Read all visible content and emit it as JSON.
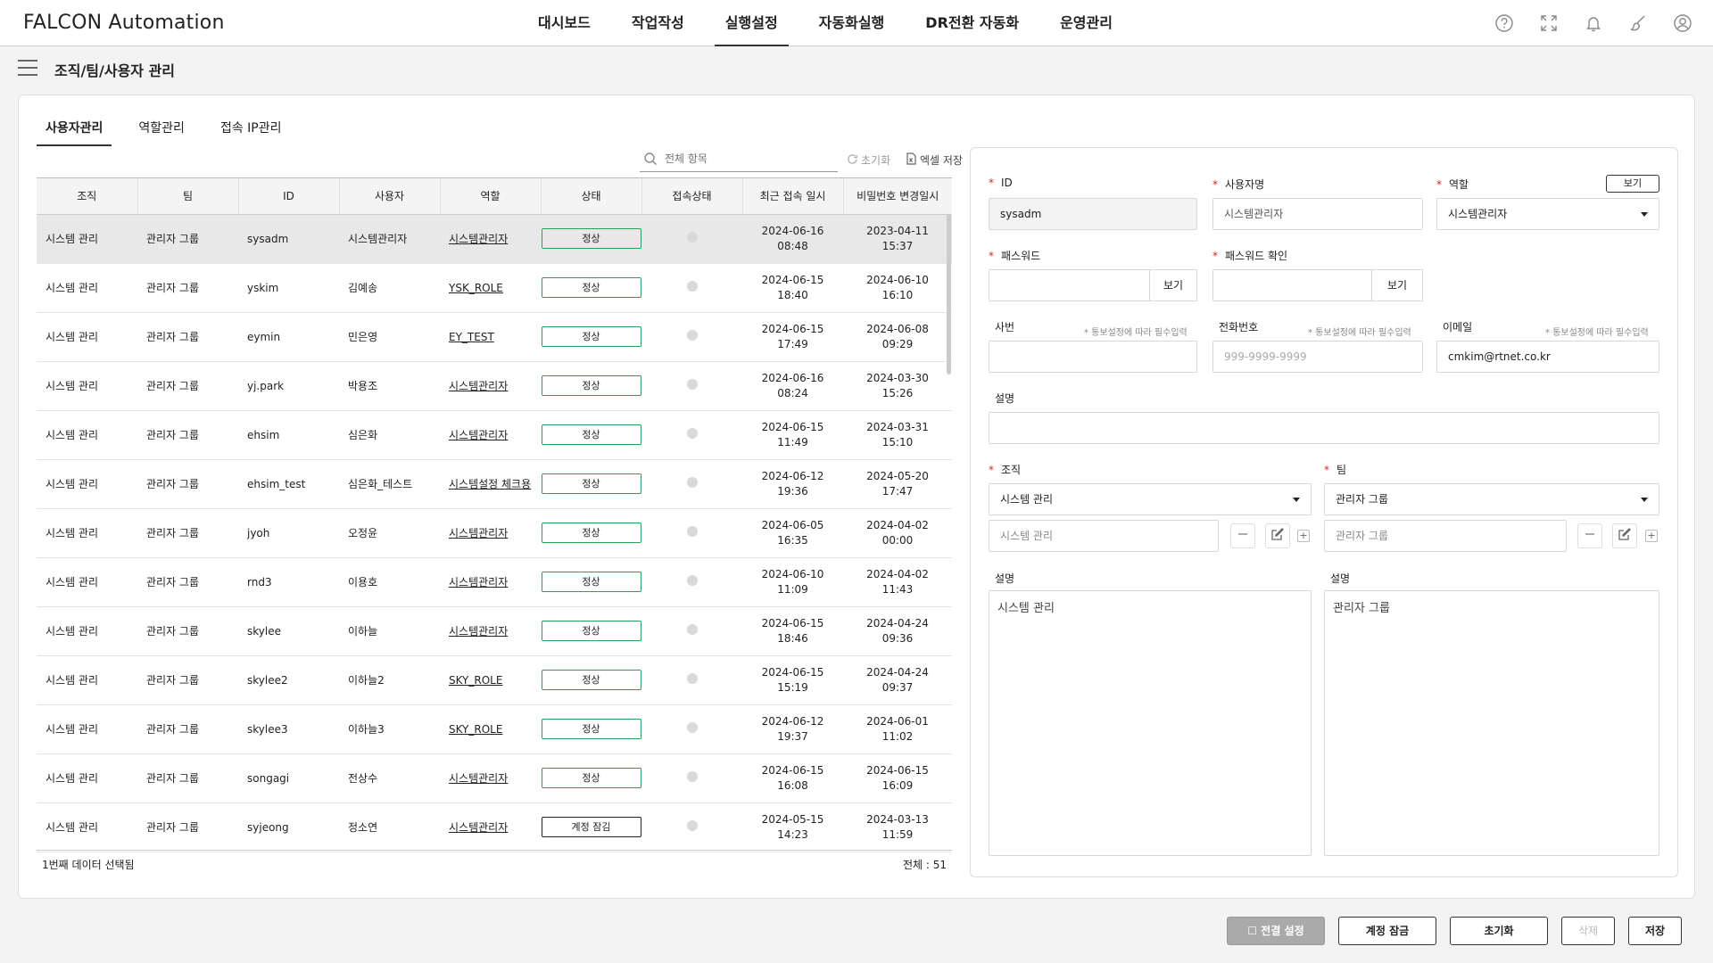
{
  "app": {
    "brand": "FALCON Automation"
  },
  "nav": {
    "menus": [
      {
        "label": "대시보드",
        "active": false
      },
      {
        "label": "작업작성",
        "active": false
      },
      {
        "label": "실행설정",
        "active": true
      },
      {
        "label": "자동화실행",
        "active": false
      },
      {
        "label": "DR전환 자동화",
        "active": false
      },
      {
        "label": "운영관리",
        "active": false
      }
    ],
    "icons": [
      "help-icon",
      "fullscreen-icon",
      "bell-icon",
      "brush-icon",
      "user-icon"
    ]
  },
  "page": {
    "title": "조직/팀/사용자 관리"
  },
  "tabs": [
    {
      "label": "사용자관리",
      "active": true
    },
    {
      "label": "역할관리",
      "active": false
    },
    {
      "label": "접속 IP관리",
      "active": false
    }
  ],
  "toolbar": {
    "search_placeholder": "전체 항목",
    "reset_label": "초기화",
    "excel_label": "엑셀 저장"
  },
  "table": {
    "columns": [
      "조직",
      "팀",
      "ID",
      "사용자",
      "역할",
      "상태",
      "접속상태",
      "최근 접속 일시",
      "비밀번호 변경일시"
    ],
    "rows": [
      {
        "org": "시스템 관리",
        "team": "관리자 그룹",
        "id": "sysadm",
        "user": "시스템관리자",
        "role": "시스템관리자",
        "status": "정상",
        "last_date": "2024-06-16",
        "last_time": "08:48",
        "pw_date": "2023-04-11",
        "pw_time": "15:37"
      },
      {
        "org": "시스템 관리",
        "team": "관리자 그룹",
        "id": "yskim",
        "user": "김예송",
        "role": "YSK_ROLE",
        "status": "정상",
        "last_date": "2024-06-15",
        "last_time": "18:40",
        "pw_date": "2024-06-10",
        "pw_time": "16:10"
      },
      {
        "org": "시스템 관리",
        "team": "관리자 그룹",
        "id": "eymin",
        "user": "민은영",
        "role": "EY_TEST",
        "status": "정상",
        "last_date": "2024-06-15",
        "last_time": "17:49",
        "pw_date": "2024-06-08",
        "pw_time": "09:29"
      },
      {
        "org": "시스템 관리",
        "team": "관리자 그룹",
        "id": "yj.park",
        "user": "박용조",
        "role": "시스템관리자",
        "status": "정상",
        "last_date": "2024-06-16",
        "last_time": "08:24",
        "pw_date": "2024-03-30",
        "pw_time": "15:26"
      },
      {
        "org": "시스템 관리",
        "team": "관리자 그룹",
        "id": "ehsim",
        "user": "심은화",
        "role": "시스템관리자",
        "status": "정상",
        "last_date": "2024-06-15",
        "last_time": "11:49",
        "pw_date": "2024-03-31",
        "pw_time": "15:10"
      },
      {
        "org": "시스템 관리",
        "team": "관리자 그룹",
        "id": "ehsim_test",
        "user": "심은화_테스트",
        "role": "시스템설정 체크용",
        "status": "정상",
        "last_date": "2024-06-12",
        "last_time": "19:36",
        "pw_date": "2024-05-20",
        "pw_time": "17:47"
      },
      {
        "org": "시스템 관리",
        "team": "관리자 그룹",
        "id": "jyoh",
        "user": "오정윤",
        "role": "시스템관리자",
        "status": "정상",
        "last_date": "2024-06-05",
        "last_time": "16:35",
        "pw_date": "2024-04-02",
        "pw_time": "00:00"
      },
      {
        "org": "시스템 관리",
        "team": "관리자 그룹",
        "id": "rnd3",
        "user": "이용호",
        "role": "시스템관리자",
        "status": "정상",
        "last_date": "2024-06-10",
        "last_time": "11:09",
        "pw_date": "2024-04-02",
        "pw_time": "11:43"
      },
      {
        "org": "시스템 관리",
        "team": "관리자 그룹",
        "id": "skylee",
        "user": "이하늘",
        "role": "시스템관리자",
        "status": "정상",
        "last_date": "2024-06-15",
        "last_time": "18:46",
        "pw_date": "2024-04-24",
        "pw_time": "09:36"
      },
      {
        "org": "시스템 관리",
        "team": "관리자 그룹",
        "id": "skylee2",
        "user": "이하늘2",
        "role": "SKY_ROLE",
        "status": "정상",
        "last_date": "2024-06-15",
        "last_time": "15:19",
        "pw_date": "2024-04-24",
        "pw_time": "09:37"
      },
      {
        "org": "시스템 관리",
        "team": "관리자 그룹",
        "id": "skylee3",
        "user": "이하늘3",
        "role": "SKY_ROLE",
        "status": "정상",
        "last_date": "2024-06-12",
        "last_time": "19:37",
        "pw_date": "2024-06-01",
        "pw_time": "11:02"
      },
      {
        "org": "시스템 관리",
        "team": "관리자 그룹",
        "id": "songagi",
        "user": "전상수",
        "role": "시스템관리자",
        "status": "정상",
        "last_date": "2024-06-15",
        "last_time": "16:08",
        "pw_date": "2024-06-15",
        "pw_time": "16:09"
      },
      {
        "org": "시스템 관리",
        "team": "관리자 그룹",
        "id": "syjeong",
        "user": "정소연",
        "role": "시스템관리자",
        "status": "계정 잠김",
        "last_date": "2024-05-15",
        "last_time": "14:23",
        "pw_date": "2024-03-13",
        "pw_time": "11:59"
      }
    ],
    "selected_row": 0,
    "footer_left": "1번째 데이터 선택됨",
    "footer_right": "전체 : 51",
    "status_colors": {
      "normal": "#2e9e57",
      "locked": "#222222"
    }
  },
  "form": {
    "id": {
      "label": "ID",
      "value": "sysadm"
    },
    "username": {
      "label": "사용자명",
      "value": "시스템관리자"
    },
    "role": {
      "label": "역할",
      "value": "시스템관리자",
      "view_label": "보기"
    },
    "password": {
      "label": "패스워드",
      "value": "",
      "view_label": "보기"
    },
    "password_confirm": {
      "label": "패스워드 확인",
      "value": "",
      "view_label": "보기"
    },
    "emp_no": {
      "label": "사번",
      "hint": "* 통보설정에 따라 필수입력",
      "value": ""
    },
    "phone": {
      "label": "전화번호",
      "hint": "* 통보설정에 따라 필수입력",
      "placeholder": "999-9999-9999"
    },
    "email": {
      "label": "이메일",
      "hint": "* 통보설정에 따라 필수입력",
      "value": "cmkim@rtnet.co.kr"
    },
    "desc": {
      "label": "설명",
      "value": ""
    },
    "org": {
      "label": "조직",
      "select_value": "시스템 관리",
      "input_value": "시스템 관리",
      "desc_label": "설명",
      "desc_value": "시스템 관리"
    },
    "team": {
      "label": "팀",
      "select_value": "관리자 그룹",
      "input_value": "관리자 그룹",
      "desc_label": "설명",
      "desc_value": "관리자 그룹"
    },
    "required_color": "#dd2222"
  },
  "actions": {
    "bulk_label": "전결 설정",
    "lock_label": "계정 잠금",
    "reset_label": "초기화",
    "delete_label": "삭제",
    "save_label": "저장"
  }
}
